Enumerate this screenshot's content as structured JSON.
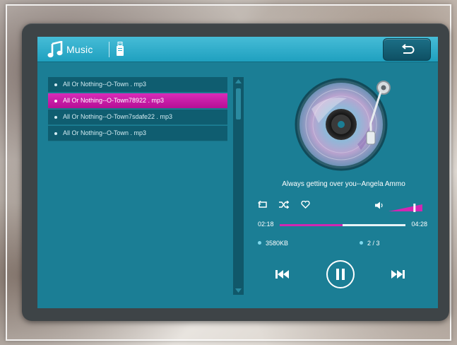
{
  "app": {
    "title": "Music"
  },
  "playlist": {
    "items": [
      {
        "label": "All Or Nothing--O-Town . mp3",
        "selected": false
      },
      {
        "label": "All Or Nothing--O-Town78922 . mp3",
        "selected": true
      },
      {
        "label": "All Or Nothing--O-Town7sdafe22 . mp3",
        "selected": false
      },
      {
        "label": "All Or Nothing--O-Town . mp3",
        "selected": false
      }
    ]
  },
  "player": {
    "song_title": "Always getting over you--Angela Ammo",
    "time_elapsed": "02:18",
    "time_total": "04:28",
    "progress": 0.5,
    "volume": 0.75,
    "file_size": "3580KB",
    "track_position": "2 / 3"
  },
  "icons": {
    "music": "music-note-icon",
    "usb": "usb-drive-icon",
    "back": "return-arrow-icon",
    "repeat": "repeat-icon",
    "shuffle": "shuffle-icon",
    "favorite": "heart-icon",
    "volume": "speaker-icon",
    "previous": "skip-previous-icon",
    "pause": "pause-icon",
    "next": "skip-next-icon"
  },
  "colors": {
    "screen_bg": "#1b7e95",
    "topbar": "#2ab0cf",
    "accent": "#c81aa6",
    "list_row": "#0f5d70"
  }
}
